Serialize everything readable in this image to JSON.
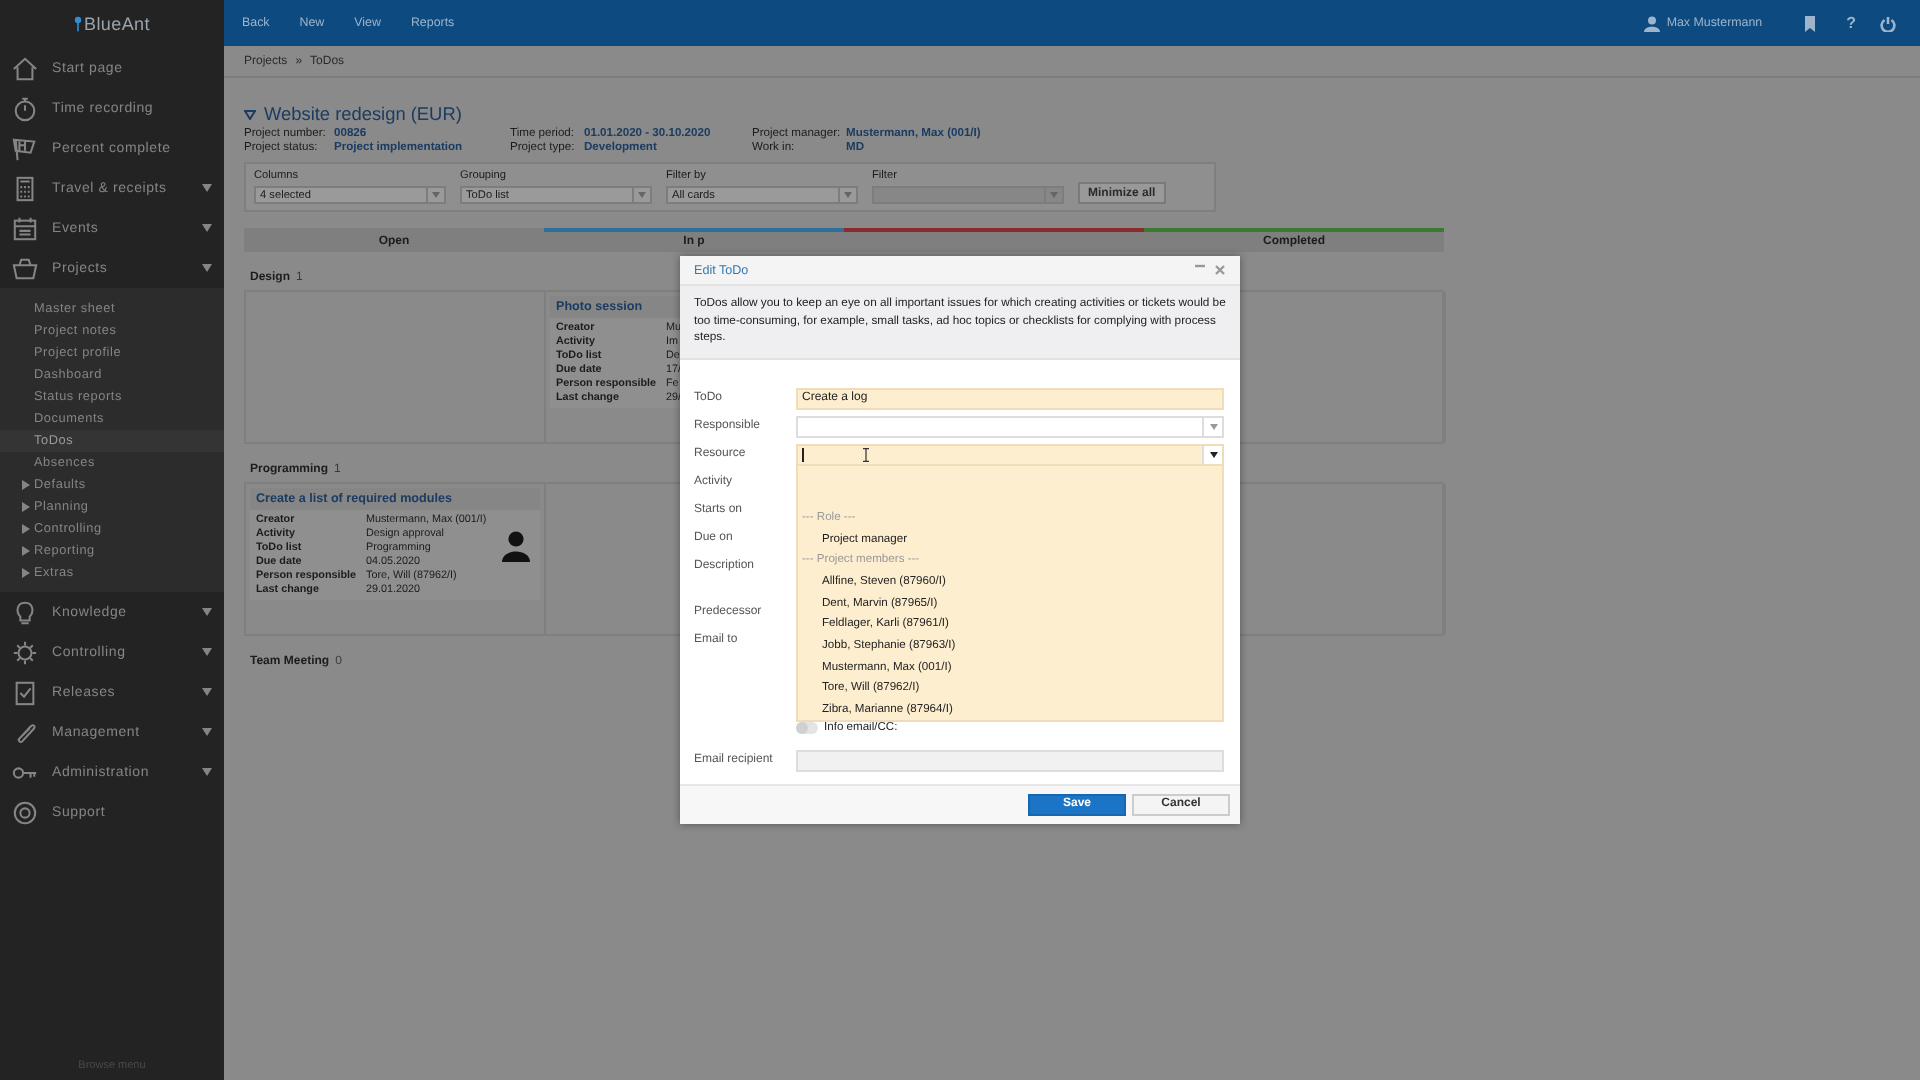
{
  "app": {
    "logo": "BlueAnt",
    "footer": "Browse menu"
  },
  "sidebar": {
    "items": [
      {
        "label": "Start page",
        "has_submenu": false
      },
      {
        "label": "Time recording",
        "has_submenu": false
      },
      {
        "label": "Percent complete",
        "has_submenu": false
      },
      {
        "label": "Travel & receipts",
        "has_submenu": true
      },
      {
        "label": "Events",
        "has_submenu": true
      },
      {
        "label": "Projects",
        "has_submenu": true,
        "children": [
          {
            "label": "Master sheet",
            "selected": false,
            "has_submenu": false
          },
          {
            "label": "Project notes",
            "selected": false,
            "has_submenu": false
          },
          {
            "label": "Project profile",
            "selected": false,
            "has_submenu": false
          },
          {
            "label": "Dashboard",
            "selected": false,
            "has_submenu": false
          },
          {
            "label": "Status reports",
            "selected": false,
            "has_submenu": false
          },
          {
            "label": "Documents",
            "selected": false,
            "has_submenu": false
          },
          {
            "label": "ToDos",
            "selected": true,
            "has_submenu": false
          },
          {
            "label": "Absences",
            "selected": false,
            "has_submenu": false
          },
          {
            "label": "Defaults",
            "selected": false,
            "has_submenu": true
          },
          {
            "label": "Planning",
            "selected": false,
            "has_submenu": true
          },
          {
            "label": "Controlling",
            "selected": false,
            "has_submenu": true
          },
          {
            "label": "Reporting",
            "selected": false,
            "has_submenu": true
          },
          {
            "label": "Extras",
            "selected": false,
            "has_submenu": true
          }
        ]
      },
      {
        "label": "Knowledge",
        "has_submenu": true
      },
      {
        "label": "Controlling",
        "has_submenu": true
      },
      {
        "label": "Releases",
        "has_submenu": true
      },
      {
        "label": "Management",
        "has_submenu": true
      },
      {
        "label": "Administration",
        "has_submenu": true
      },
      {
        "label": "Support",
        "has_submenu": false
      }
    ]
  },
  "top_bar": {
    "nav": [
      "Back",
      "New",
      "View",
      "Reports"
    ],
    "user": "Max Mustermann",
    "help": "?"
  },
  "breadcrumb": {
    "items": [
      "Projects",
      "ToDos"
    ],
    "separator": "»"
  },
  "project": {
    "title": "Website redesign (EUR)",
    "expanded": true,
    "fields": [
      {
        "label": "Project number:",
        "value": "00826"
      },
      {
        "label": "Time period:",
        "value": "01.01.2020 - 30.10.2020"
      },
      {
        "label": "Project manager:",
        "value": "Mustermann, Max (001/I)"
      },
      {
        "label": "Project status:",
        "value": "Project implementation"
      },
      {
        "label": "Project type:",
        "value": "Development"
      },
      {
        "label": "Work in:",
        "value": "MD"
      }
    ]
  },
  "filters": {
    "controls": [
      {
        "label": "Columns",
        "value": "4 selected",
        "disabled": false
      },
      {
        "label": "Grouping",
        "value": "ToDo list",
        "disabled": false
      },
      {
        "label": "Filter by",
        "value": "All cards",
        "disabled": false
      },
      {
        "label": "Filter",
        "disabled": true
      }
    ],
    "button": "Minimize all"
  },
  "board": {
    "columns": [
      {
        "label": "Open"
      },
      {
        "label": "In p",
        "color": "#2f6f9c"
      },
      {
        "color": "#8c2b2b"
      },
      {
        "label": "Completed",
        "color": "#3c7a33"
      }
    ],
    "groups": [
      {
        "label": "Design",
        "count": "1",
        "cells": [
          {
            "kind": "empty"
          },
          {
            "kind": "card",
            "title": "Photo session",
            "fields": [
              {
                "label": "Creator",
                "value": "Mu"
              },
              {
                "label": "Activity",
                "value": "Im"
              },
              {
                "label": "ToDo list",
                "value": "De"
              },
              {
                "label": "Due date",
                "value": "17/"
              },
              {
                "label": "Person responsible",
                "value": "Fe"
              },
              {
                "label": "Last change",
                "value": "29/"
              }
            ]
          },
          {
            "kind": "empty"
          },
          {
            "kind": "empty"
          }
        ]
      },
      {
        "label": "Programming",
        "count": "1",
        "cells": [
          {
            "kind": "card",
            "title": "Create a list of required modules",
            "avatar": true,
            "fields": [
              {
                "label": "Creator",
                "value": "Mustermann, Max (001/I)"
              },
              {
                "label": "Activity",
                "value": "Design approval"
              },
              {
                "label": "ToDo list",
                "value": "Programming"
              },
              {
                "label": "Due date",
                "value": "04.05.2020"
              },
              {
                "label": "Person responsible",
                "value": "Tore, Will (87962/I)"
              },
              {
                "label": "Last change",
                "value": "29.01.2020"
              }
            ]
          },
          {
            "kind": "empty"
          },
          {
            "kind": "empty"
          },
          {
            "kind": "empty"
          }
        ]
      },
      {
        "label": "Team Meeting",
        "count": "0"
      }
    ]
  },
  "dialog": {
    "title": "Edit ToDo",
    "intro": "ToDos allow you to keep an eye on all important issues for which creating activities or tickets would be too time-consuming, for example, small tasks, ad hoc topics or checklists for complying with process steps.",
    "fields": [
      {
        "label": "ToDo",
        "kind": "text",
        "value": "Create a log",
        "required": true,
        "focused": false
      },
      {
        "label": "Responsible",
        "kind": "dropdown",
        "required": false,
        "focused": false,
        "open": false
      },
      {
        "label": "Resource",
        "kind": "dropdown",
        "required": true,
        "focused": true,
        "open": true
      },
      {
        "label": "Activity",
        "kind": "covered"
      },
      {
        "label": "Starts on",
        "kind": "covered"
      },
      {
        "label": "Due on",
        "kind": "covered"
      },
      {
        "label": "Description",
        "kind": "covered",
        "tall": true
      },
      {
        "label": "Predecessor",
        "kind": "covered"
      },
      {
        "label": "Email to",
        "kind": "covered"
      }
    ],
    "dropdown_list": {
      "groups": [
        {
          "heading": "--- Role ---",
          "options": [
            "Project manager"
          ]
        },
        {
          "heading": "--- Project members ---",
          "options": [
            "Allfine, Steven (87960/I)",
            "Dent, Marvin (87965/I)",
            "Feldlager, Karli (87961/I)",
            "Jobb, Stephanie (87963/I)",
            "Mustermann, Max (001/I)",
            "Tore, Will (87962/I)",
            "Zibra, Marianne (87964/I)"
          ]
        }
      ]
    },
    "info_email": {
      "label": "Info email/CC:",
      "on": false
    },
    "email_recipient": {
      "label": "Email recipient",
      "disabled": true
    },
    "buttons": [
      {
        "label": "Save",
        "kind": "primary"
      },
      {
        "label": "Cancel",
        "kind": "secondary"
      }
    ]
  }
}
